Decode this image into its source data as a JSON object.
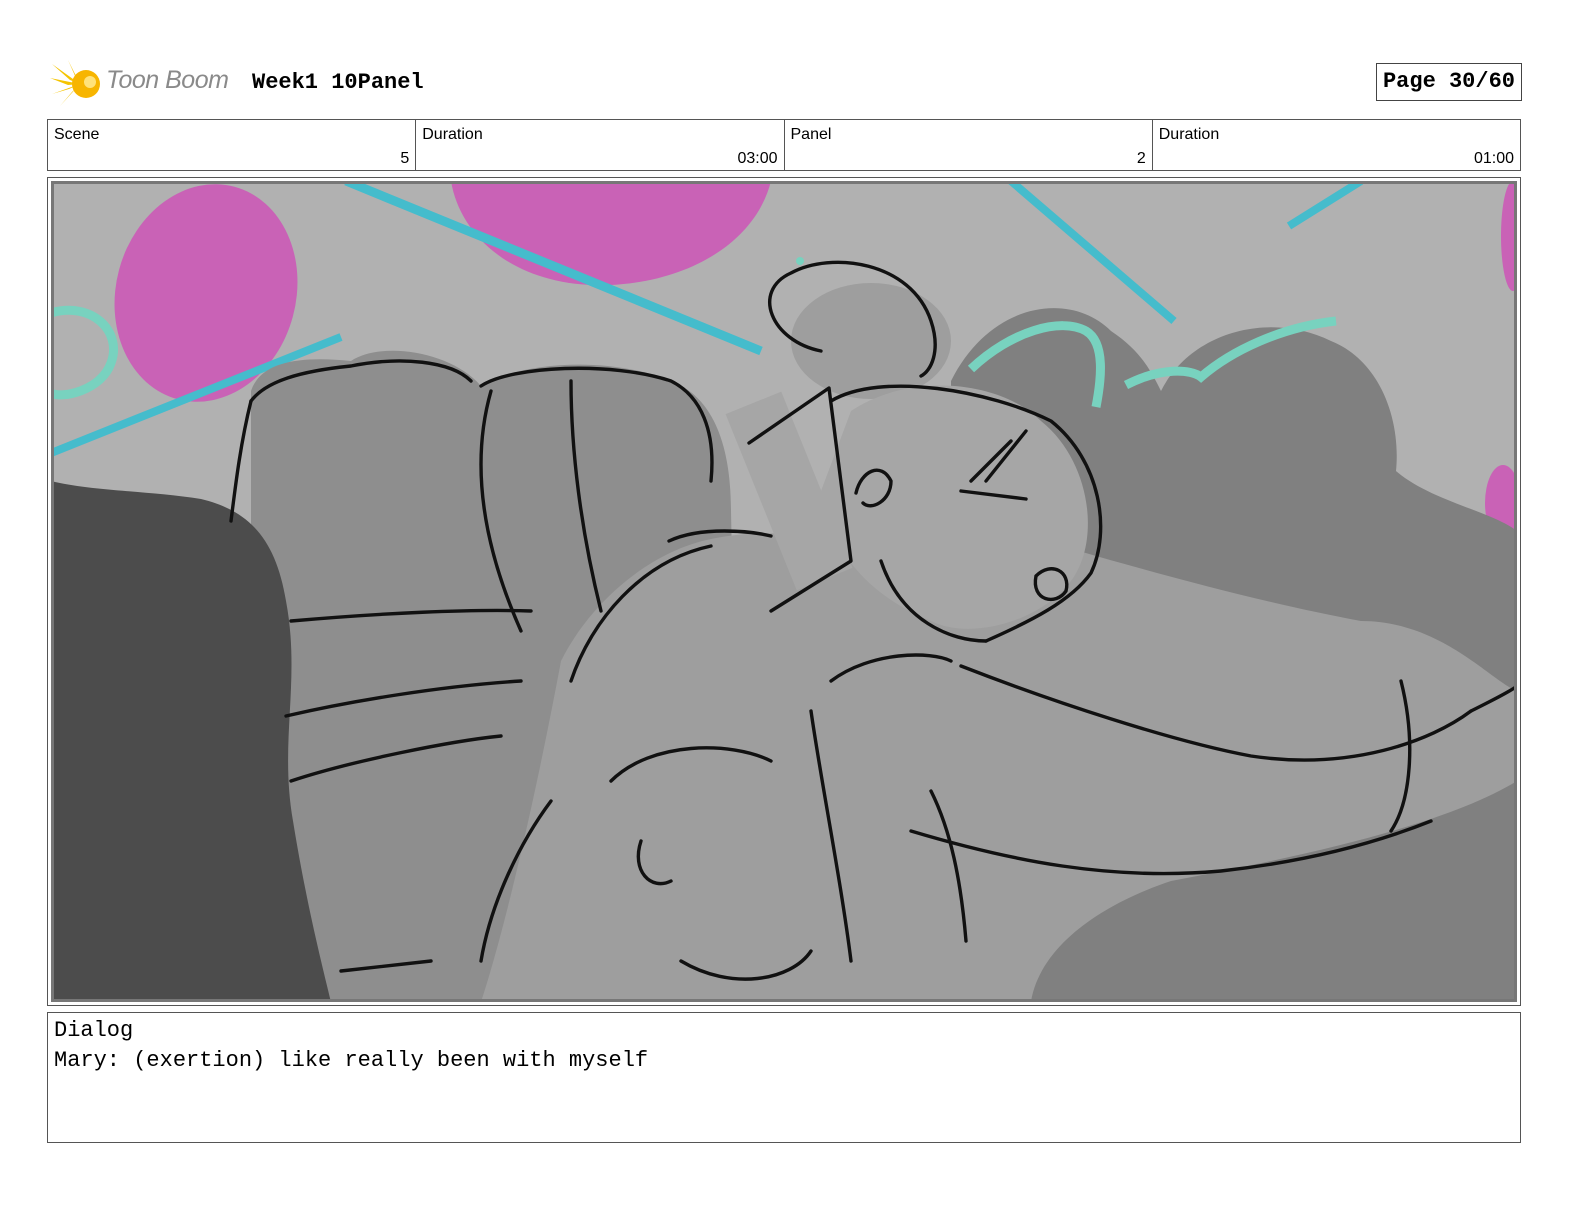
{
  "header": {
    "logo_text": "Toon Boom",
    "doc_title": "Week1 10Panel",
    "page_label": "Page 30/60"
  },
  "info": {
    "scene_label": "Scene",
    "scene_value": "5",
    "scene_duration_label": "Duration",
    "scene_duration_value": "03:00",
    "panel_label": "Panel",
    "panel_value": "2",
    "panel_duration_label": "Duration",
    "panel_duration_value": "01:00"
  },
  "dialog": {
    "title": "Dialog",
    "text": "Mary: (exertion) like really been with myself"
  },
  "colors": {
    "logo_yellow": "#f5c400",
    "magenta": "#c962b6",
    "cyan": "#45bccc",
    "mint": "#78d2bf",
    "bg_gray": "#b1b1b1"
  },
  "icons": {
    "logo": "toon-boom-star-icon"
  }
}
